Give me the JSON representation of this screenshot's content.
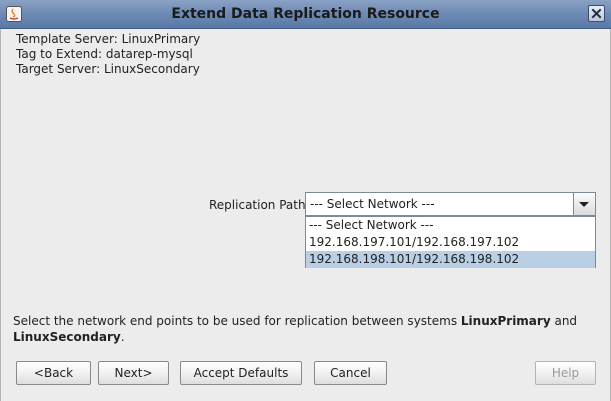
{
  "window": {
    "title": "Extend Data Replication Resource"
  },
  "info": {
    "template_server": "Template Server: LinuxPrimary",
    "tag_to_extend": "Tag to Extend: datarep-mysql",
    "target_server": "Target Server: LinuxSecondary"
  },
  "replication_path": {
    "label": "Replication Path",
    "current_value": "--- Select Network ---",
    "options": [
      "--- Select Network ---",
      "192.168.197.101/192.168.197.102",
      "192.168.198.101/192.168.198.102"
    ],
    "highlighted_option": "192.168.198.101/192.168.198.102"
  },
  "description": {
    "prefix": "Select the network end points to be used for replication between systems ",
    "system1": "LinuxPrimary",
    "conjunction": " and ",
    "system2": "LinuxSecondary",
    "suffix": "."
  },
  "buttons": {
    "back": "<Back",
    "next": "Next>",
    "accept_defaults": "Accept Defaults",
    "cancel": "Cancel",
    "help": "Help"
  },
  "colors": {
    "titlebar": "#6f8bb5",
    "selection": "#b8cfe5",
    "background": "#ececec"
  }
}
